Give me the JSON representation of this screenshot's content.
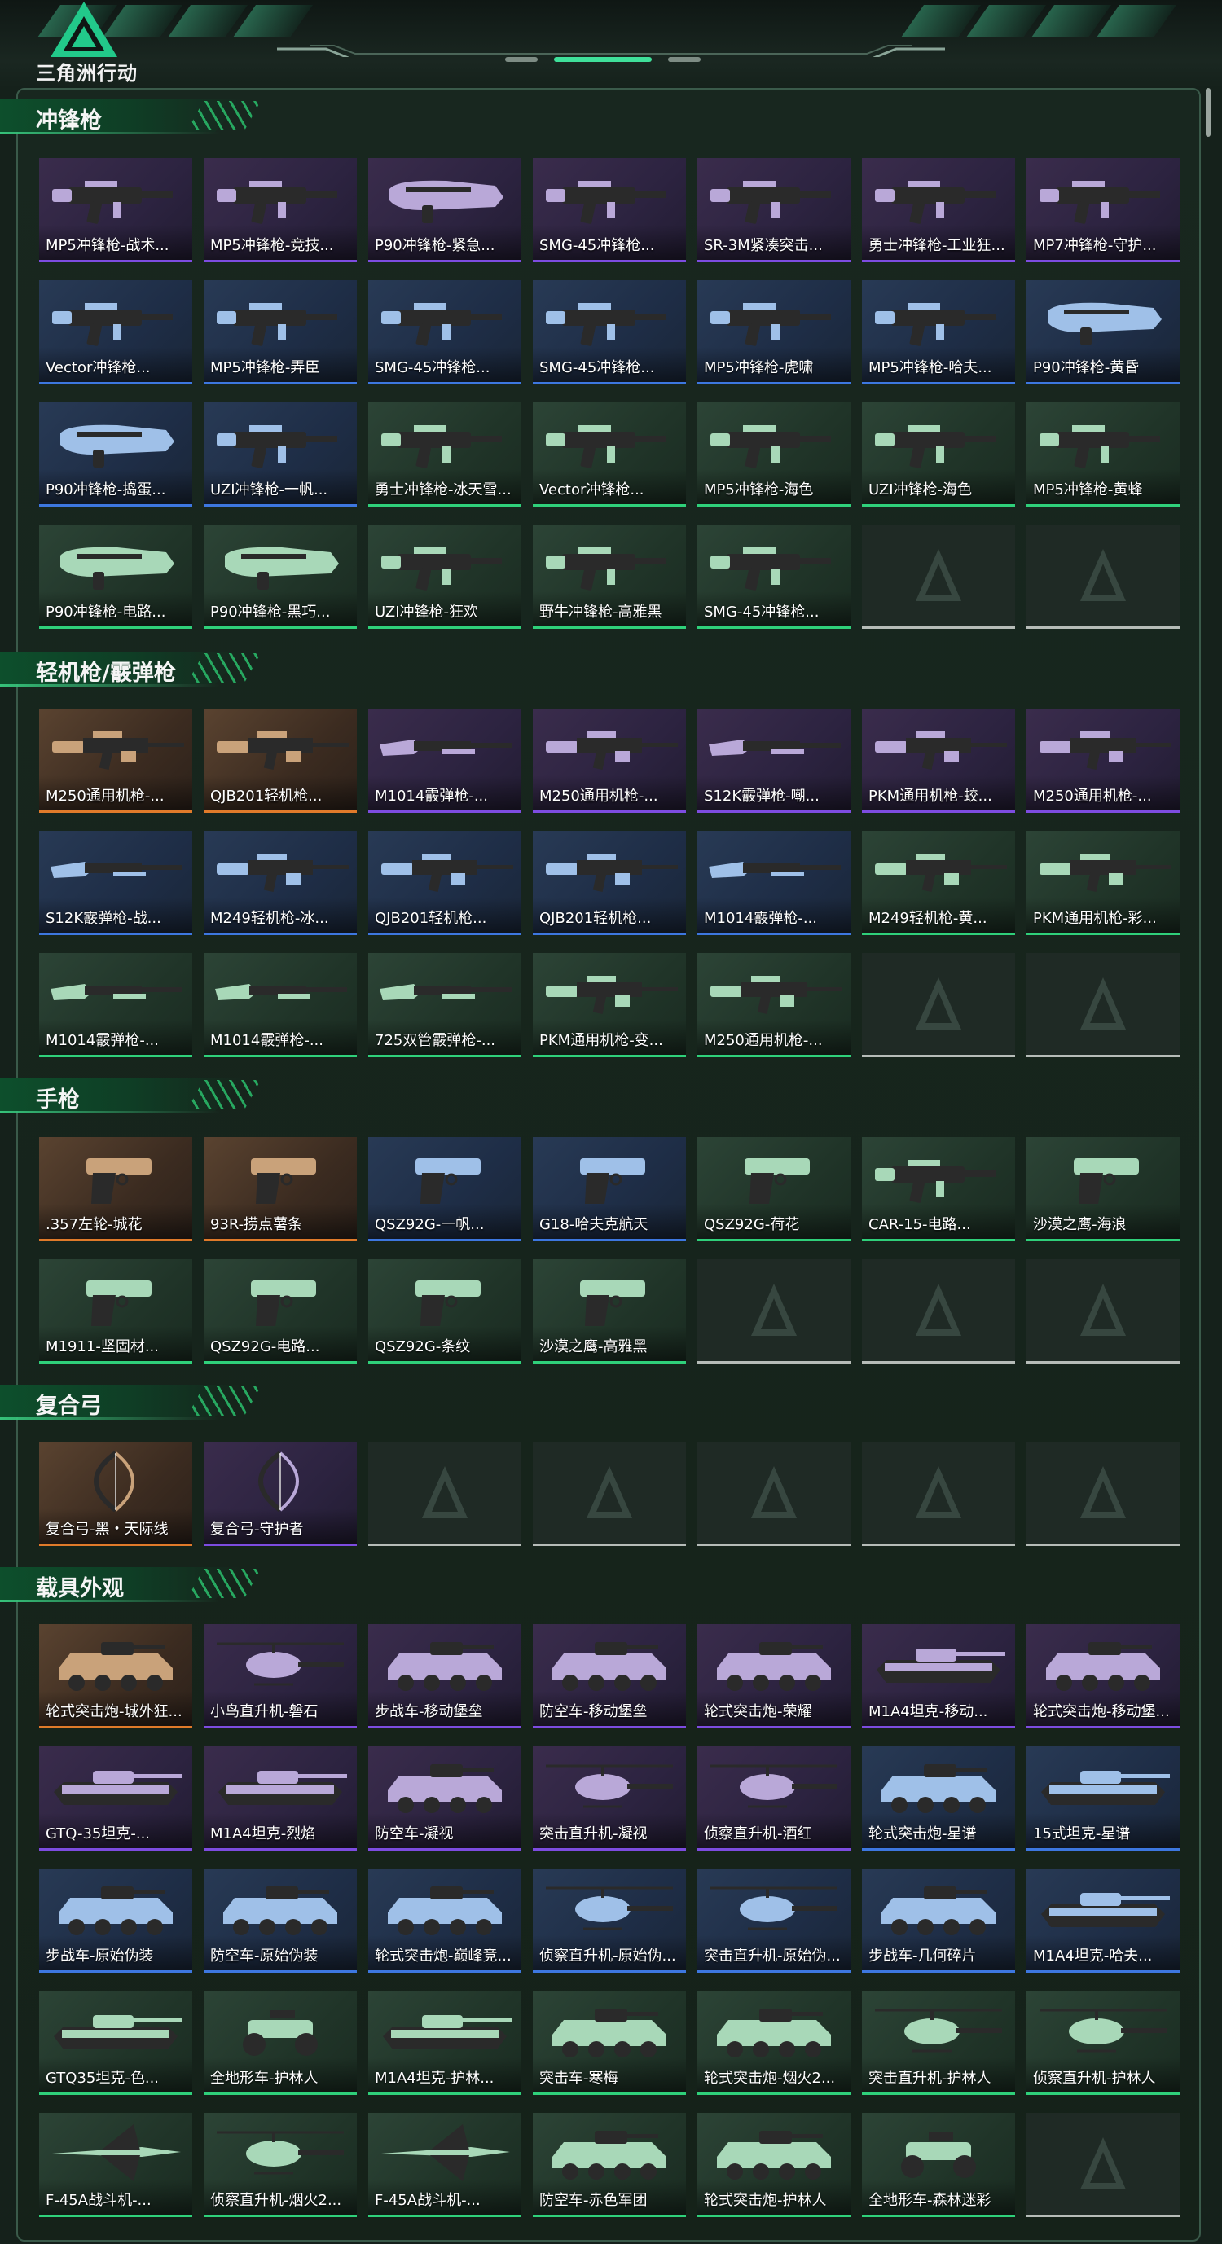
{
  "app": {
    "logo_text": "三角洲行动"
  },
  "colors": {
    "gold": "#e07a2a",
    "purple": "#7d4ce0",
    "blue": "#3d77e0",
    "green": "#2fd07a",
    "empty": "#b6bcb8",
    "accent": "#36c27a"
  },
  "sections": [
    {
      "title": "冲锋枪",
      "items": [
        {
          "name": "MP5冲锋枪-战术...",
          "rarity": "purple",
          "icon": "smg"
        },
        {
          "name": "MP5冲锋枪-竞技...",
          "rarity": "purple",
          "icon": "smg"
        },
        {
          "name": "P90冲锋枪-紧急...",
          "rarity": "purple",
          "icon": "bullpup"
        },
        {
          "name": "SMG-45冲锋枪...",
          "rarity": "purple",
          "icon": "smg"
        },
        {
          "name": "SR-3M紧凑突击...",
          "rarity": "purple",
          "icon": "smg"
        },
        {
          "name": "勇士冲锋枪-工业狂...",
          "rarity": "purple",
          "icon": "smg"
        },
        {
          "name": "MP7冲锋枪-守护...",
          "rarity": "purple",
          "icon": "smg"
        },
        {
          "name": "Vector冲锋枪...",
          "rarity": "blue",
          "icon": "smg"
        },
        {
          "name": "MP5冲锋枪-弄臣",
          "rarity": "blue",
          "icon": "smg"
        },
        {
          "name": "SMG-45冲锋枪...",
          "rarity": "blue",
          "icon": "smg"
        },
        {
          "name": "SMG-45冲锋枪...",
          "rarity": "blue",
          "icon": "smg"
        },
        {
          "name": "MP5冲锋枪-虎啸",
          "rarity": "blue",
          "icon": "smg"
        },
        {
          "name": "MP5冲锋枪-哈夫...",
          "rarity": "blue",
          "icon": "smg"
        },
        {
          "name": "P90冲锋枪-黄昏",
          "rarity": "blue",
          "icon": "bullpup"
        },
        {
          "name": "P90冲锋枪-捣蛋...",
          "rarity": "blue",
          "icon": "bullpup"
        },
        {
          "name": "UZI冲锋枪-一帆...",
          "rarity": "blue",
          "icon": "smg"
        },
        {
          "name": "勇士冲锋枪-冰天雪...",
          "rarity": "green",
          "icon": "smg"
        },
        {
          "name": "Vector冲锋枪...",
          "rarity": "green",
          "icon": "smg"
        },
        {
          "name": "MP5冲锋枪-海色",
          "rarity": "green",
          "icon": "smg"
        },
        {
          "name": "UZI冲锋枪-海色",
          "rarity": "green",
          "icon": "smg"
        },
        {
          "name": "MP5冲锋枪-黄蜂",
          "rarity": "green",
          "icon": "smg"
        },
        {
          "name": "P90冲锋枪-电路...",
          "rarity": "green",
          "icon": "bullpup"
        },
        {
          "name": "P90冲锋枪-黑巧...",
          "rarity": "green",
          "icon": "bullpup"
        },
        {
          "name": "UZI冲锋枪-狂欢",
          "rarity": "green",
          "icon": "smg"
        },
        {
          "name": "野牛冲锋枪-高雅黑",
          "rarity": "green",
          "icon": "smg"
        },
        {
          "name": "SMG-45冲锋枪...",
          "rarity": "green",
          "icon": "smg"
        },
        {
          "name": "",
          "rarity": "empty",
          "icon": ""
        },
        {
          "name": "",
          "rarity": "empty",
          "icon": ""
        }
      ]
    },
    {
      "title": "轻机枪/霰弹枪",
      "items": [
        {
          "name": "M250通用机枪-...",
          "rarity": "gold",
          "icon": "rifle"
        },
        {
          "name": "QJB201轻机枪...",
          "rarity": "gold",
          "icon": "rifle"
        },
        {
          "name": "M1014霰弹枪-...",
          "rarity": "purple",
          "icon": "shotgun"
        },
        {
          "name": "M250通用机枪-...",
          "rarity": "purple",
          "icon": "rifle"
        },
        {
          "name": "S12K霰弹枪-嘲...",
          "rarity": "purple",
          "icon": "shotgun"
        },
        {
          "name": "PKM通用机枪-蛟...",
          "rarity": "purple",
          "icon": "rifle"
        },
        {
          "name": "M250通用机枪-...",
          "rarity": "purple",
          "icon": "rifle"
        },
        {
          "name": "S12K霰弹枪-战...",
          "rarity": "blue",
          "icon": "shotgun"
        },
        {
          "name": "M249轻机枪-冰...",
          "rarity": "blue",
          "icon": "rifle"
        },
        {
          "name": "QJB201轻机枪...",
          "rarity": "blue",
          "icon": "rifle"
        },
        {
          "name": "QJB201轻机枪...",
          "rarity": "blue",
          "icon": "rifle"
        },
        {
          "name": "M1014霰弹枪-...",
          "rarity": "blue",
          "icon": "shotgun"
        },
        {
          "name": "M249轻机枪-黄...",
          "rarity": "green",
          "icon": "rifle"
        },
        {
          "name": "PKM通用机枪-彩...",
          "rarity": "green",
          "icon": "rifle"
        },
        {
          "name": "M1014霰弹枪-...",
          "rarity": "green",
          "icon": "shotgun"
        },
        {
          "name": "M1014霰弹枪-...",
          "rarity": "green",
          "icon": "shotgun"
        },
        {
          "name": "725双管霰弹枪-...",
          "rarity": "green",
          "icon": "shotgun"
        },
        {
          "name": "PKM通用机枪-变...",
          "rarity": "green",
          "icon": "rifle"
        },
        {
          "name": "M250通用机枪-...",
          "rarity": "green",
          "icon": "rifle"
        },
        {
          "name": "",
          "rarity": "empty",
          "icon": ""
        },
        {
          "name": "",
          "rarity": "empty",
          "icon": ""
        }
      ]
    },
    {
      "title": "手枪",
      "items": [
        {
          "name": ".357左轮-城花",
          "rarity": "gold",
          "icon": "pistol"
        },
        {
          "name": "93R-捞点薯条",
          "rarity": "gold",
          "icon": "pistol"
        },
        {
          "name": "QSZ92G-一帆...",
          "rarity": "blue",
          "icon": "pistol"
        },
        {
          "name": "G18-哈夫克航天",
          "rarity": "blue",
          "icon": "pistol"
        },
        {
          "name": "QSZ92G-荷花",
          "rarity": "green",
          "icon": "pistol"
        },
        {
          "name": "CAR-15-电路...",
          "rarity": "green",
          "icon": "smg"
        },
        {
          "name": "沙漠之鹰-海浪",
          "rarity": "green",
          "icon": "pistol"
        },
        {
          "name": "M1911-坚固材...",
          "rarity": "green",
          "icon": "pistol"
        },
        {
          "name": "QSZ92G-电路...",
          "rarity": "green",
          "icon": "pistol"
        },
        {
          "name": "QSZ92G-条纹",
          "rarity": "green",
          "icon": "pistol"
        },
        {
          "name": "沙漠之鹰-高雅黑",
          "rarity": "green",
          "icon": "pistol"
        },
        {
          "name": "",
          "rarity": "empty",
          "icon": ""
        },
        {
          "name": "",
          "rarity": "empty",
          "icon": ""
        },
        {
          "name": "",
          "rarity": "empty",
          "icon": ""
        }
      ]
    },
    {
      "title": "复合弓",
      "items": [
        {
          "name": "复合弓-黑・天际线",
          "rarity": "gold",
          "icon": "bow"
        },
        {
          "name": "复合弓-守护者",
          "rarity": "purple",
          "icon": "bow"
        },
        {
          "name": "",
          "rarity": "empty",
          "icon": ""
        },
        {
          "name": "",
          "rarity": "empty",
          "icon": ""
        },
        {
          "name": "",
          "rarity": "empty",
          "icon": ""
        },
        {
          "name": "",
          "rarity": "empty",
          "icon": ""
        },
        {
          "name": "",
          "rarity": "empty",
          "icon": ""
        }
      ]
    },
    {
      "title": "载具外观",
      "items": [
        {
          "name": "轮式突击炮-城外狂...",
          "rarity": "gold",
          "icon": "vehicle"
        },
        {
          "name": "小鸟直升机-磐石",
          "rarity": "purple",
          "icon": "heli"
        },
        {
          "name": "步战车-移动堡垒",
          "rarity": "purple",
          "icon": "vehicle"
        },
        {
          "name": "防空车-移动堡垒",
          "rarity": "purple",
          "icon": "vehicle"
        },
        {
          "name": "轮式突击炮-荣耀",
          "rarity": "purple",
          "icon": "vehicle"
        },
        {
          "name": "M1A4坦克-移动...",
          "rarity": "purple",
          "icon": "tank"
        },
        {
          "name": "轮式突击炮-移动堡...",
          "rarity": "purple",
          "icon": "vehicle"
        },
        {
          "name": "GTQ-35坦克-...",
          "rarity": "purple",
          "icon": "tank"
        },
        {
          "name": "M1A4坦克-烈焰",
          "rarity": "purple",
          "icon": "tank"
        },
        {
          "name": "防空车-凝视",
          "rarity": "purple",
          "icon": "vehicle"
        },
        {
          "name": "突击直升机-凝视",
          "rarity": "purple",
          "icon": "heli"
        },
        {
          "name": "侦察直升机-酒红",
          "rarity": "purple",
          "icon": "heli"
        },
        {
          "name": "轮式突击炮-星谱",
          "rarity": "blue",
          "icon": "vehicle"
        },
        {
          "name": "15式坦克-星谱",
          "rarity": "blue",
          "icon": "tank"
        },
        {
          "name": "步战车-原始伪装",
          "rarity": "blue",
          "icon": "vehicle"
        },
        {
          "name": "防空车-原始伪装",
          "rarity": "blue",
          "icon": "vehicle"
        },
        {
          "name": "轮式突击炮-巅峰竞...",
          "rarity": "blue",
          "icon": "vehicle"
        },
        {
          "name": "侦察直升机-原始伪...",
          "rarity": "blue",
          "icon": "heli"
        },
        {
          "name": "突击直升机-原始伪...",
          "rarity": "blue",
          "icon": "heli"
        },
        {
          "name": "步战车-几何碎片",
          "rarity": "blue",
          "icon": "vehicle"
        },
        {
          "name": "M1A4坦克-哈夫...",
          "rarity": "blue",
          "icon": "tank"
        },
        {
          "name": "GTQ35坦克-色...",
          "rarity": "green",
          "icon": "tank"
        },
        {
          "name": "全地形车-护林人",
          "rarity": "green",
          "icon": "atv"
        },
        {
          "name": "M1A4坦克-护林...",
          "rarity": "green",
          "icon": "tank"
        },
        {
          "name": "突击车-寒梅",
          "rarity": "green",
          "icon": "vehicle"
        },
        {
          "name": "轮式突击炮-烟火2...",
          "rarity": "green",
          "icon": "vehicle"
        },
        {
          "name": "突击直升机-护林人",
          "rarity": "green",
          "icon": "heli"
        },
        {
          "name": "侦察直升机-护林人",
          "rarity": "green",
          "icon": "heli"
        },
        {
          "name": "F-45A战斗机-...",
          "rarity": "green",
          "icon": "jet"
        },
        {
          "name": "侦察直升机-烟火2...",
          "rarity": "green",
          "icon": "heli"
        },
        {
          "name": "F-45A战斗机-...",
          "rarity": "green",
          "icon": "jet"
        },
        {
          "name": "防空车-赤色军团",
          "rarity": "green",
          "icon": "vehicle"
        },
        {
          "name": "轮式突击炮-护林人",
          "rarity": "green",
          "icon": "vehicle"
        },
        {
          "name": "全地形车-森林迷彩",
          "rarity": "green",
          "icon": "atv"
        },
        {
          "name": "",
          "rarity": "empty",
          "icon": ""
        }
      ]
    }
  ]
}
